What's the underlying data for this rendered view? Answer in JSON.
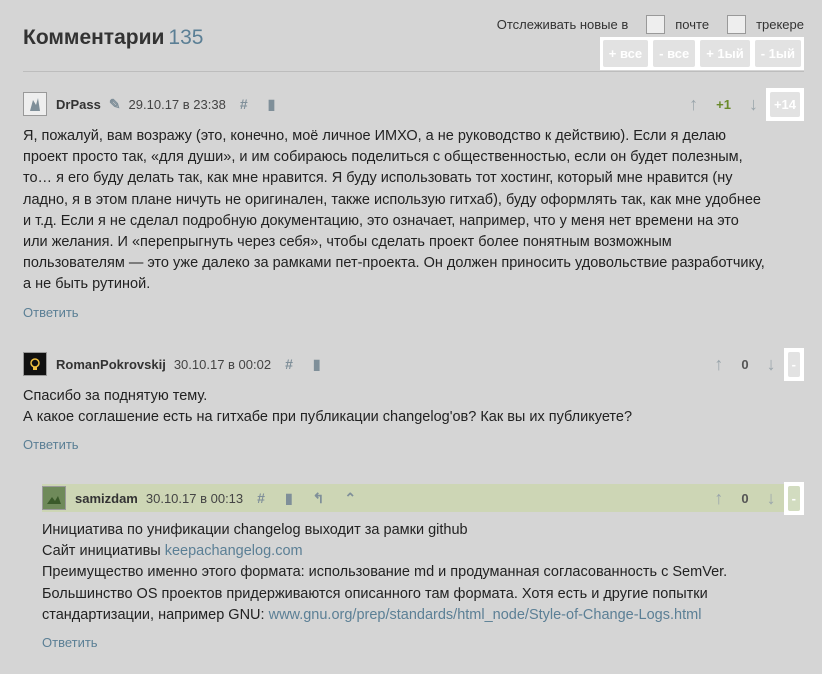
{
  "header": {
    "title": "Комментарии",
    "count": "135"
  },
  "tracking": {
    "label": "Отслеживать новые в",
    "option_mail": "почте",
    "option_tracker": "трекере",
    "buttons": [
      "+ все",
      "- все",
      "+ 1ый",
      "- 1ый"
    ]
  },
  "comments": [
    {
      "user": "DrPass",
      "date": "29.10.17 в 23:38",
      "vote": "+1",
      "score": "+14",
      "lines": [
        "Я, пожалуй, вам возражу (это, конечно, моё личное ИМХО, а не руководство к действию). Если я делаю",
        "проект просто так, «для души», и им собираюсь поделиться с общественностью, если он будет полезным,",
        "то… я его буду делать так, как мне нравится. Я буду использовать тот хостинг, который мне нравится (ну",
        "ладно, я в этом плане ничуть не оригинален, также использую гитхаб), буду оформлять так, как мне удобнее",
        "и т.д. Если я не сделал подробную документацию, это означает, например, что у меня нет времени на это",
        "или желания. И «перепрыгнуть через себя», чтобы сделать проект более понятным возможным",
        "пользователям — это уже далеко за рамками пет-проекта. Он должен приносить удовольствие разработчику,",
        "а не быть рутиной."
      ],
      "reply": "Ответить"
    },
    {
      "user": "RomanPokrovskij",
      "date": "30.10.17 в 00:02",
      "vote": "0",
      "score": "-",
      "lines": [
        "Спасибо за поднятую тему.",
        "А какое соглашение есть на гитхабе при публикации changelog'ов? Как вы их публикуете?"
      ],
      "reply": "Ответить"
    },
    {
      "user": "samizdam",
      "date": "30.10.17 в 00:13",
      "vote": "0",
      "score": "-",
      "lines": [
        "Инициатива по унификации changelog выходит за рамки github",
        "Сайт инициативы",
        "Преимущество именно этого формата: использование md и продуманная согласованность с SemVer.",
        "Большинство OS проектов придерживаются описанного там формата. Хотя есть и другие попытки",
        "стандартизации, например GNU:"
      ],
      "link1": "keepachangelog.com",
      "link2": "www.gnu.org/prep/standards/html_node/Style-of-Change-Logs.html",
      "reply": "Ответить"
    }
  ],
  "icons": {
    "edit": "pencil-icon",
    "anchor": "hash-icon",
    "bookmark": "bookmark-icon",
    "parent": "parent-link-icon",
    "collapse": "chevron-up-icon",
    "up": "arrow-up-icon",
    "down": "arrow-down-icon"
  }
}
